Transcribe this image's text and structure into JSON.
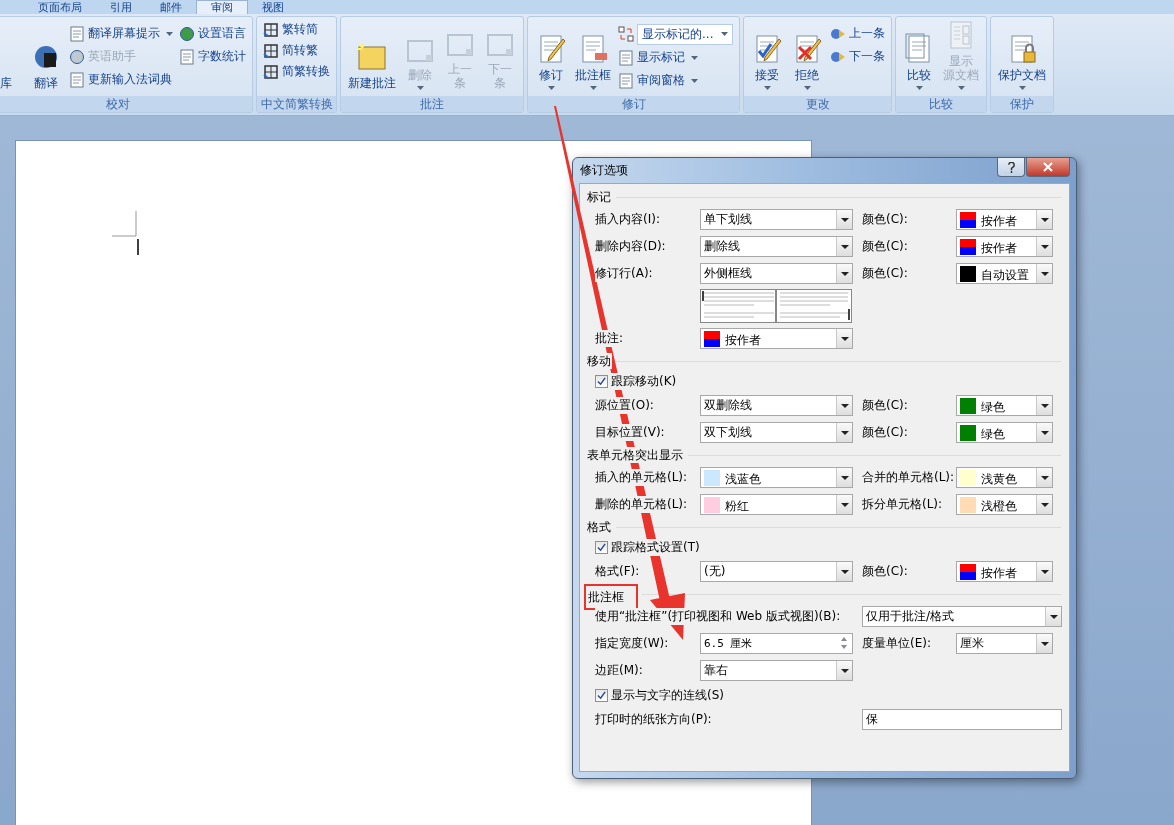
{
  "tabs": [
    {
      "label": "页面布局",
      "selected": false
    },
    {
      "label": "引用",
      "selected": false
    },
    {
      "label": "邮件",
      "selected": false
    },
    {
      "label": "审阅",
      "selected": true
    },
    {
      "label": "视图",
      "selected": false
    }
  ],
  "ribbon_groups": [
    {
      "label": "校对",
      "columns": [
        {
          "kind": "large",
          "items": [
            {
              "label": "库",
              "disabled": false,
              "dropdown": false
            }
          ]
        },
        {
          "kind": "large",
          "items": [
            {
              "label": "翻译",
              "disabled": false,
              "dropdown": false
            }
          ]
        },
        {
          "kind": "stack",
          "items": [
            {
              "kind": "button",
              "label": "翻译屏幕提示",
              "disabled": false,
              "dropdown": true
            },
            {
              "kind": "button",
              "label": "英语助手",
              "disabled": true,
              "dropdown": false
            },
            {
              "kind": "button",
              "label": "更新输入法词典",
              "disabled": false,
              "dropdown": false
            }
          ]
        },
        {
          "kind": "stack",
          "items": [
            {
              "kind": "button",
              "label": "设置语言",
              "disabled": false,
              "dropdown": false
            },
            {
              "kind": "button",
              "label": "字数统计",
              "disabled": false,
              "dropdown": false
            }
          ]
        }
      ]
    },
    {
      "label": "中文简繁转换",
      "columns": [
        {
          "kind": "stack",
          "items": [
            {
              "kind": "button",
              "label": "繁转简",
              "disabled": false,
              "dropdown": false
            },
            {
              "kind": "button",
              "label": "简转繁",
              "disabled": false,
              "dropdown": false
            },
            {
              "kind": "button",
              "label": "简繁转换",
              "disabled": false,
              "dropdown": false
            }
          ]
        }
      ]
    },
    {
      "label": "批注",
      "columns": [
        {
          "kind": "large",
          "items": [
            {
              "label": "新建批注",
              "disabled": false,
              "dropdown": false
            }
          ]
        },
        {
          "kind": "large",
          "items": [
            {
              "label": "删除",
              "disabled": true,
              "dropdown": true
            }
          ]
        },
        {
          "kind": "large",
          "items": [
            {
              "lines": [
                "上一",
                "条"
              ],
              "disabled": true,
              "dropdown": false
            }
          ]
        },
        {
          "kind": "large",
          "items": [
            {
              "lines": [
                "下一",
                "条"
              ],
              "disabled": true,
              "dropdown": false
            }
          ]
        }
      ]
    },
    {
      "label": "修订",
      "columns": [
        {
          "kind": "large",
          "items": [
            {
              "label": "修订",
              "disabled": false,
              "dropdown": true
            }
          ]
        },
        {
          "kind": "large",
          "items": [
            {
              "label": "批注框",
              "disabled": false,
              "dropdown": true
            }
          ]
        },
        {
          "kind": "stack",
          "items": [
            {
              "kind": "combo",
              "label": "显示标记的...",
              "disabled": false,
              "dropdown": true
            },
            {
              "kind": "button",
              "label": "显示标记",
              "disabled": false,
              "dropdown": true
            },
            {
              "kind": "button",
              "label": "审阅窗格",
              "disabled": false,
              "dropdown": true
            }
          ]
        }
      ]
    },
    {
      "label": "更改",
      "columns": [
        {
          "kind": "large",
          "items": [
            {
              "label": "接受",
              "disabled": false,
              "dropdown": true
            }
          ]
        },
        {
          "kind": "large",
          "items": [
            {
              "label": "拒绝",
              "disabled": false,
              "dropdown": true
            }
          ]
        },
        {
          "kind": "stack",
          "items": [
            {
              "kind": "button",
              "label": "上一条",
              "disabled": false,
              "dropdown": false
            },
            {
              "kind": "button",
              "label": "下一条",
              "disabled": false,
              "dropdown": false
            }
          ]
        }
      ]
    },
    {
      "label": "比较",
      "columns": [
        {
          "kind": "large",
          "items": [
            {
              "label": "比较",
              "disabled": false,
              "dropdown": true
            }
          ]
        },
        {
          "kind": "large",
          "items": [
            {
              "lines": [
                "显示",
                "源文档"
              ],
              "disabled": true,
              "dropdown": true
            }
          ]
        }
      ]
    },
    {
      "label": "保护",
      "columns": [
        {
          "kind": "large",
          "items": [
            {
              "label": "保护文档",
              "disabled": false,
              "dropdown": true
            }
          ]
        }
      ]
    }
  ],
  "dialog": {
    "title": "修订选项",
    "sections": [
      {
        "title": "标记",
        "highlighted": false,
        "rows": [
          {
            "kind": "fields",
            "fields": [
              {
                "kind": "dropdown",
                "label": "插入内容(I):",
                "value": "单下划线"
              },
              {
                "kind": "dropdown",
                "label": "颜色(C):",
                "value": "按作者",
                "swatch": [
                  {
                    "color": "#ff0000"
                  },
                  {
                    "color": "#0000ff"
                  }
                ]
              }
            ]
          },
          {
            "kind": "fields",
            "fields": [
              {
                "kind": "dropdown",
                "label": "删除内容(D):",
                "value": "删除线"
              },
              {
                "kind": "dropdown",
                "label": "颜色(C):",
                "value": "按作者",
                "swatch": [
                  {
                    "color": "#ff0000"
                  },
                  {
                    "color": "#0000ff"
                  }
                ]
              }
            ]
          },
          {
            "kind": "fields",
            "fields": [
              {
                "kind": "dropdown",
                "label": "修订行(A):",
                "value": "外侧框线"
              },
              {
                "kind": "dropdown",
                "label": "颜色(C):",
                "value": "自动设置",
                "swatch": [
                  {
                    "color": "#000000"
                  }
                ]
              }
            ]
          },
          {
            "kind": "preview"
          },
          {
            "kind": "fields",
            "fields": [
              {
                "kind": "dropdown",
                "label": "批注:",
                "value": "按作者",
                "swatch": [
                  {
                    "color": "#ff0000"
                  },
                  {
                    "color": "#0000ff"
                  }
                ]
              }
            ]
          }
        ]
      },
      {
        "title": "移动",
        "highlighted": false,
        "rows": [
          {
            "kind": "checkbox",
            "label": "跟踪移动(K)",
            "checked": true
          },
          {
            "kind": "fields",
            "fields": [
              {
                "kind": "dropdown",
                "label": "源位置(O):",
                "value": "双删除线"
              },
              {
                "kind": "dropdown",
                "label": "颜色(C):",
                "value": "绿色",
                "swatch": [
                  {
                    "color": "#008000"
                  }
                ]
              }
            ]
          },
          {
            "kind": "fields",
            "fields": [
              {
                "kind": "dropdown",
                "label": "目标位置(V):",
                "value": "双下划线"
              },
              {
                "kind": "dropdown",
                "label": "颜色(C):",
                "value": "绿色",
                "swatch": [
                  {
                    "color": "#008000"
                  }
                ]
              }
            ]
          }
        ]
      },
      {
        "title": "表单元格突出显示",
        "highlighted": false,
        "rows": [
          {
            "kind": "fields",
            "fields": [
              {
                "kind": "dropdown",
                "label": "插入的单元格(L):",
                "value": "浅蓝色",
                "swatch": [
                  {
                    "color": "#cce8ff"
                  }
                ]
              },
              {
                "kind": "dropdown",
                "label": "合并的单元格(L):",
                "value": "浅黄色",
                "swatch": [
                  {
                    "color": "#ffffcc"
                  }
                ]
              }
            ]
          },
          {
            "kind": "fields",
            "fields": [
              {
                "kind": "dropdown",
                "label": "删除的单元格(L):",
                "value": "粉红",
                "swatch": [
                  {
                    "color": "#ffcce0"
                  }
                ]
              },
              {
                "kind": "dropdown",
                "label": "拆分单元格(L):",
                "value": "浅橙色",
                "swatch": [
                  {
                    "color": "#ffdcb4"
                  }
                ]
              }
            ]
          }
        ]
      },
      {
        "title": "格式",
        "highlighted": false,
        "rows": [
          {
            "kind": "checkbox",
            "label": "跟踪格式设置(T)",
            "checked": true
          },
          {
            "kind": "fields",
            "fields": [
              {
                "kind": "dropdown",
                "label": "格式(F):",
                "value": "(无)"
              },
              {
                "kind": "dropdown",
                "label": "颜色(C):",
                "value": "按作者",
                "swatch": [
                  {
                    "color": "#ff0000"
                  },
                  {
                    "color": "#0000ff"
                  }
                ]
              }
            ]
          }
        ]
      },
      {
        "title": "批注框",
        "highlighted": true,
        "rows": [
          {
            "kind": "wide",
            "label": "使用“批注框”(打印视图和 Web 版式视图)(B):",
            "value": "仅用于批注/格式",
            "dropdown": true
          },
          {
            "kind": "fields",
            "fields": [
              {
                "kind": "spin",
                "label": "指定宽度(W):",
                "value": "6.5 厘米"
              },
              {
                "kind": "dropdown",
                "label": "度量单位(E):",
                "value": "厘米"
              }
            ]
          },
          {
            "kind": "fields",
            "fields": [
              {
                "kind": "dropdown",
                "label": "边距(M):",
                "value": "靠右"
              }
            ]
          },
          {
            "kind": "checkbox",
            "label": "显示与文字的连线(S)",
            "checked": true
          },
          {
            "kind": "wide",
            "label": "打印时的纸张方向(P):",
            "value": "保",
            "dropdown": false
          }
        ]
      }
    ]
  }
}
